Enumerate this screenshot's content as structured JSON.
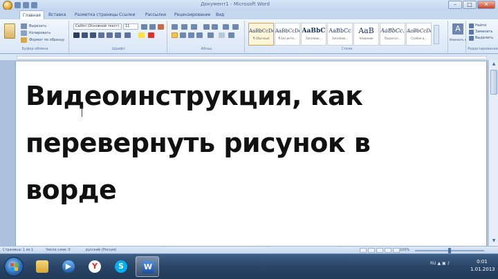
{
  "window": {
    "title": "Документ1 - Microsoft Word",
    "minimize": "–",
    "maximize": "□",
    "close": "✕"
  },
  "tabs": [
    "Главная",
    "Вставка",
    "Разметка страницы",
    "Ссылки",
    "Рассылки",
    "Рецензирование",
    "Вид"
  ],
  "ribbon": {
    "clipboard": {
      "cut": "Вырезать",
      "copy": "Копировать",
      "format_painter": "Формат по образцу",
      "label": "Буфер обмена"
    },
    "font": {
      "font_name": "Calibri (Основной текст)",
      "font_size": "11",
      "label": "Шрифт"
    },
    "paragraph": {
      "label": "Абзац"
    },
    "styles": {
      "label": "Стили",
      "items": [
        {
          "sample": "AaBbCcDc",
          "name": "¶ Обычный"
        },
        {
          "sample": "AaBbCcDc",
          "name": "¶ Без инте..."
        },
        {
          "sample": "AaBbC",
          "name": "Заголово..."
        },
        {
          "sample": "AaBbCc",
          "name": "Заголово..."
        },
        {
          "sample": "AaB",
          "name": "Название"
        },
        {
          "sample": "AaBbCc.",
          "name": "Подзагол..."
        },
        {
          "sample": "AaBbCcDc",
          "name": "Слабое в..."
        }
      ],
      "change_styles": "Изменить стили"
    },
    "editing": {
      "find": "Найти",
      "replace": "Заменить",
      "select": "Выделить",
      "label": "Редактирование"
    }
  },
  "document": {
    "text": "Видеоинструкция, как перевернуть рисунок в ворде"
  },
  "statusbar": {
    "page": "Страница: 1 из 1",
    "words": "Число слов: 0",
    "language": "русский (Россия)",
    "zoom": "100%"
  },
  "taskbar": {
    "tray_lang": "RU",
    "time": "0:01",
    "date": "1.01.2013"
  }
}
